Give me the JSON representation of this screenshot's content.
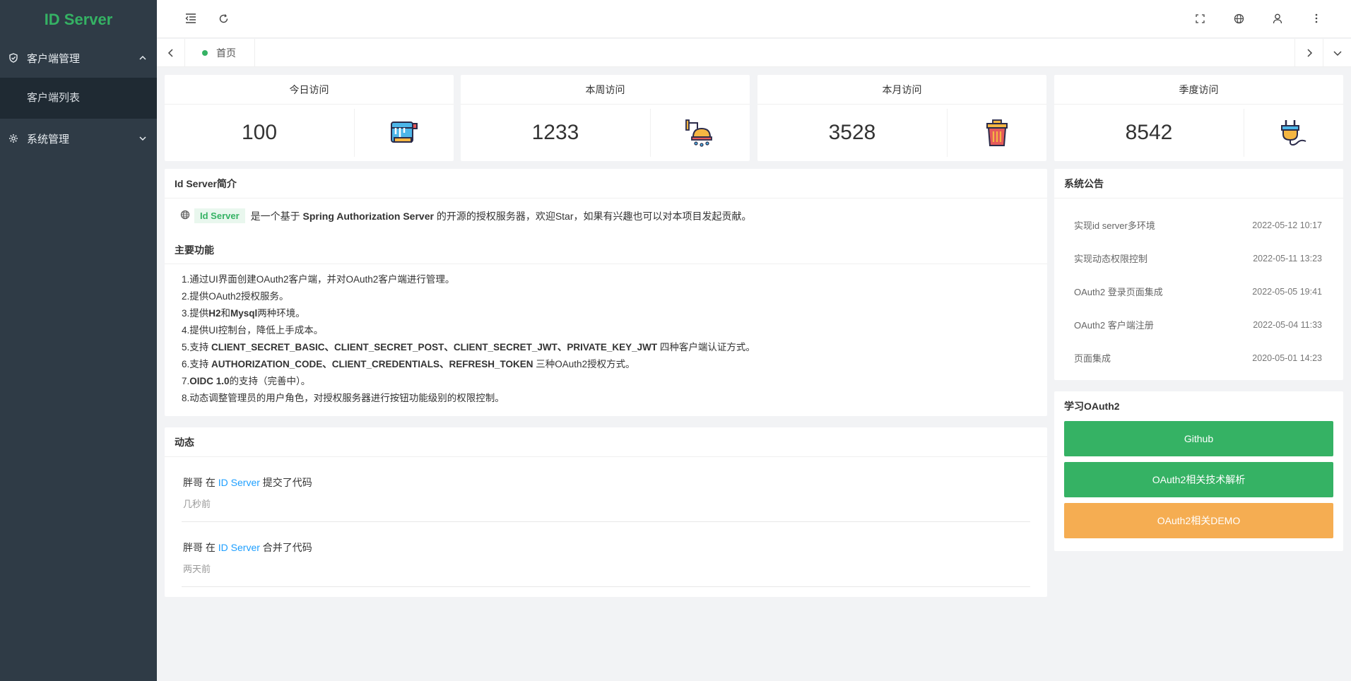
{
  "app": {
    "title": "ID Server"
  },
  "sidebar": {
    "groups": [
      {
        "label": "客户端管理",
        "expanded": true,
        "icon": "shield-check-icon",
        "children": [
          {
            "label": "客户端列表"
          }
        ]
      },
      {
        "label": "系统管理",
        "expanded": false,
        "icon": "gear-icon",
        "children": []
      }
    ]
  },
  "header": {
    "icons": [
      "menu-fold-icon",
      "refresh-icon",
      "fullscreen-icon",
      "globe-icon",
      "user-icon",
      "more-vertical-icon"
    ]
  },
  "tabs": [
    {
      "label": "首页",
      "active": true
    }
  ],
  "stats": [
    {
      "title": "今日访问",
      "value": "100",
      "icon": "paint-bucket-icon"
    },
    {
      "title": "本周访问",
      "value": "1233",
      "icon": "shower-icon"
    },
    {
      "title": "本月访问",
      "value": "3528",
      "icon": "trash-can-icon"
    },
    {
      "title": "季度访问",
      "value": "8542",
      "icon": "plug-icon"
    }
  ],
  "intro": {
    "title": "Id Server简介",
    "badge": "Id Server",
    "text_1": "是一个基于",
    "text_bold": "Spring Authorization Server",
    "text_2": "的开源的授权服务器，欢迎Star，如果有兴趣也可以对本项目发起贡献。",
    "features_title": "主要功能",
    "features": [
      {
        "pre": "1.通过UI界面创建OAuth2客户端，并对OAuth2客户端进行管理。",
        "bold": "",
        "post": ""
      },
      {
        "pre": "2.提供OAuth2授权服务。",
        "bold": "",
        "post": ""
      },
      {
        "pre": "3.提供",
        "bold": "H2",
        "mid": "和",
        "bold2": "Mysql",
        "post": "两种环境。"
      },
      {
        "pre": "4.提供UI控制台，降低上手成本。",
        "bold": "",
        "post": ""
      },
      {
        "pre": "5.支持 ",
        "bold": "CLIENT_SECRET_BASIC、CLIENT_SECRET_POST、CLIENT_SECRET_JWT、PRIVATE_KEY_JWT",
        "post": " 四种客户端认证方式。"
      },
      {
        "pre": "6.支持 ",
        "bold": "AUTHORIZATION_CODE、CLIENT_CREDENTIALS、REFRESH_TOKEN",
        "post": " 三种OAuth2授权方式。"
      },
      {
        "pre": "7.",
        "bold": "OIDC 1.0",
        "post": "的支持（完善中）。"
      },
      {
        "pre": "8.动态调整管理员的用户角色，对授权服务器进行按钮功能级别的权限控制。",
        "bold": "",
        "post": ""
      }
    ]
  },
  "activity": {
    "title": "动态",
    "items": [
      {
        "user": "胖哥",
        "at": "在",
        "project": "ID Server",
        "action": "提交了代码",
        "time": "几秒前"
      },
      {
        "user": "胖哥",
        "at": "在",
        "project": "ID Server",
        "action": "合并了代码",
        "time": "两天前"
      }
    ]
  },
  "notices": {
    "title": "系统公告",
    "items": [
      {
        "text": "实现id server多环境",
        "date": "2022-05-12 10:17"
      },
      {
        "text": "实现动态权限控制",
        "date": "2022-05-11 13:23"
      },
      {
        "text": "OAuth2 登录页面集成",
        "date": "2022-05-05 19:41"
      },
      {
        "text": "OAuth2 客户端注册",
        "date": "2022-05-04 11:33"
      },
      {
        "text": "页面集成",
        "date": "2020-05-01 14:23"
      }
    ]
  },
  "learn": {
    "title": "学习OAuth2",
    "buttons": [
      {
        "label": "Github",
        "color": "#35b264"
      },
      {
        "label": "OAuth2相关技术解析",
        "color": "#35b264"
      },
      {
        "label": "OAuth2相关DEMO",
        "color": "#f5ad52"
      }
    ]
  }
}
